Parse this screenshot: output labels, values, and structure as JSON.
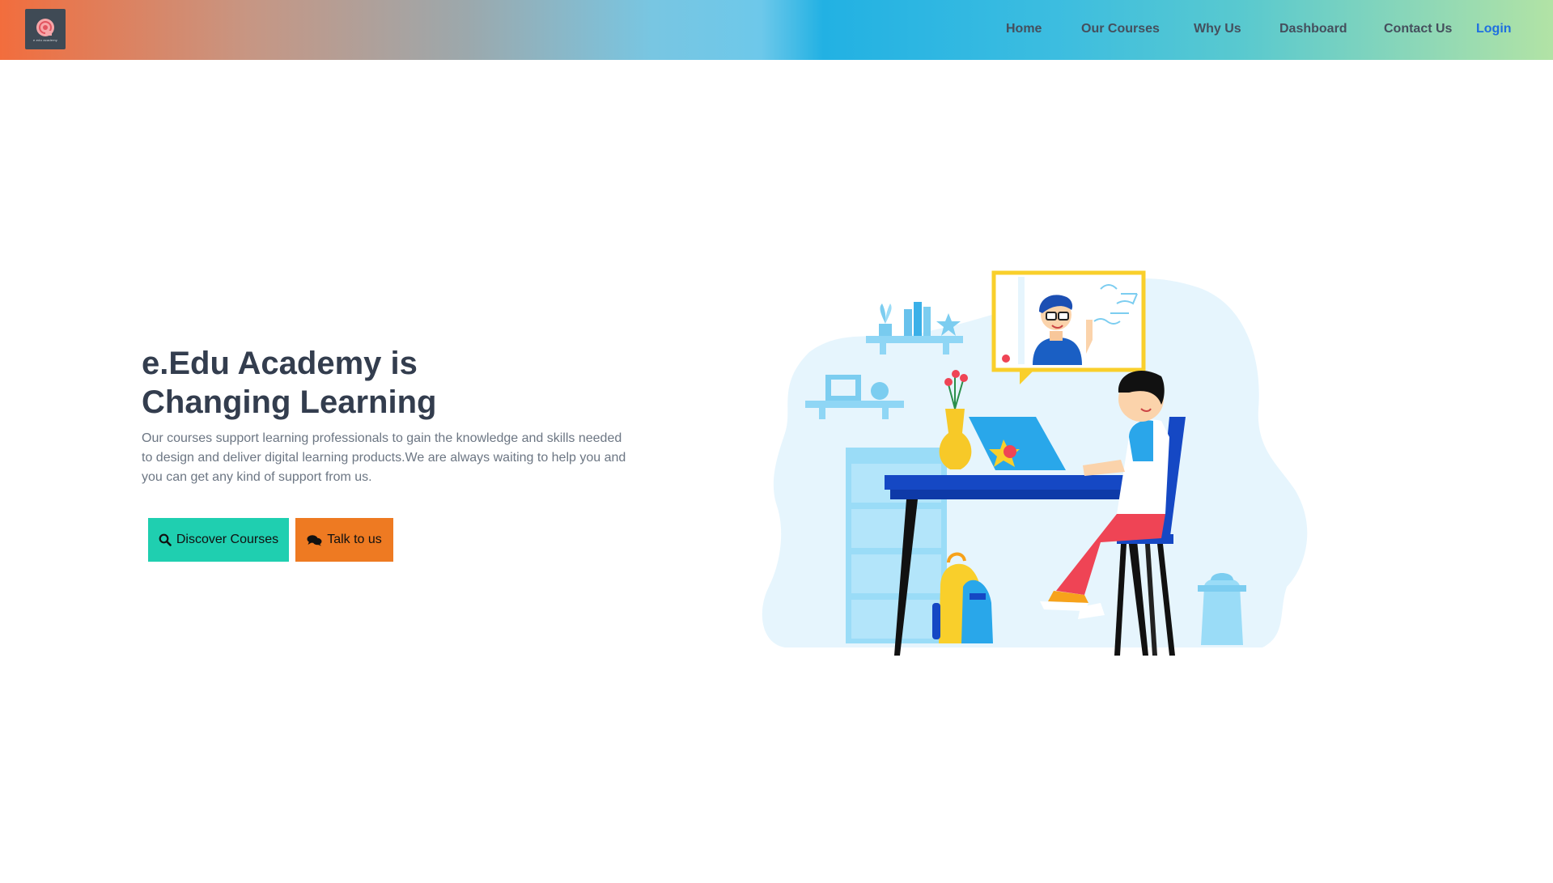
{
  "brand": {
    "logo_icon": "e-shell-logo",
    "logo_text": "e.edu academy"
  },
  "nav": {
    "items": [
      {
        "label": "Home"
      },
      {
        "label": "Our Courses"
      },
      {
        "label": "Why Us"
      },
      {
        "label": "Dashboard"
      },
      {
        "label": "Contact Us"
      },
      {
        "label": "Login"
      }
    ]
  },
  "hero": {
    "title_line1": "e.Edu Academy is",
    "title_line2": "Changing Learning",
    "description": "Our courses support learning professionals to gain the knowledge and skills needed to design and deliver digital learning products.We are always waiting to help you and you can get any kind of support from us.",
    "discover_label": "Discover Courses",
    "discover_icon": "search-icon",
    "talk_label": "Talk to us",
    "talk_icon": "comments-icon"
  },
  "colors": {
    "discover_button": "#1fcfb0",
    "talk_button": "#ee7a22",
    "login_link": "#1f6fe0",
    "heading": "#333d4e"
  },
  "illustration": {
    "icon": "student-online-class-illustration"
  }
}
